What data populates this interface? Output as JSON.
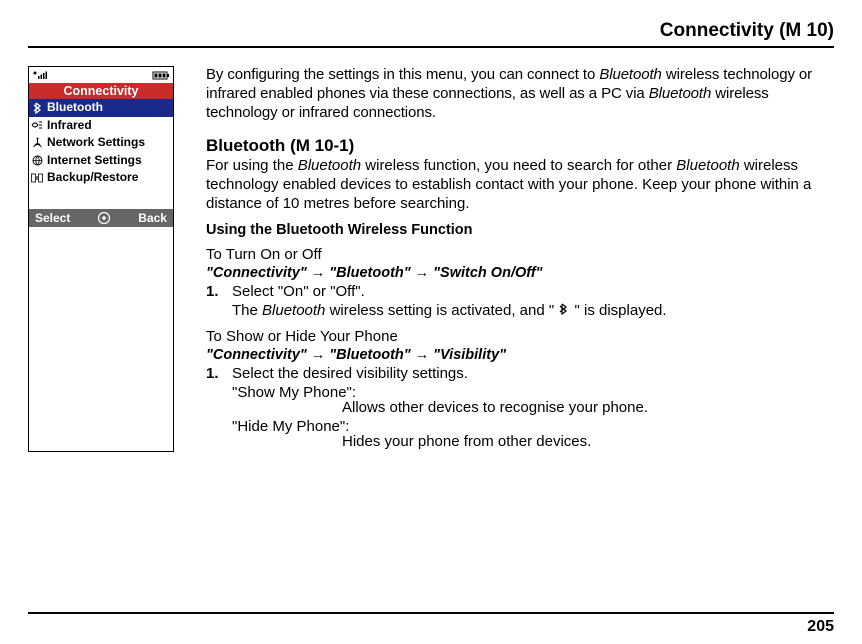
{
  "header": {
    "section": "Connectivity",
    "menu_code": "(M 10)"
  },
  "phone": {
    "title": "Connectivity",
    "items": [
      {
        "icon": "bluetooth-icon",
        "label": "Bluetooth",
        "selected": true
      },
      {
        "icon": "infrared-icon",
        "label": "Infrared",
        "selected": false
      },
      {
        "icon": "network-icon",
        "label": "Network Settings",
        "selected": false
      },
      {
        "icon": "globe-icon",
        "label": "Internet Settings",
        "selected": false
      },
      {
        "icon": "backup-icon",
        "label": "Backup/Restore",
        "selected": false
      }
    ],
    "softkeys": {
      "left": "Select",
      "right": "Back"
    }
  },
  "body": {
    "intro_before": "By configuring the settings in this menu, you can connect to ",
    "intro_bt1": "Bluetooth",
    "intro_mid": " wireless technology or infrared enabled phones via these connections, as well as a PC via ",
    "intro_bt2": "Bluetooth",
    "intro_after": " wireless technology or infrared connections.",
    "h2": "Bluetooth",
    "h2_code": "(M 10-1)",
    "p1_a": "For using the ",
    "p1_b": "Bluetooth",
    "p1_c": " wireless function, you need to search for other ",
    "p1_d": "Bluetooth",
    "p1_e": " wireless technology enabled devices to establish contact with your phone. Keep your phone within a distance of 10 metres before searching.",
    "h3": "Using the Bluetooth Wireless Function",
    "h4a": "To Turn On or Off",
    "nav1_a": "\"Connectivity\"",
    "nav1_b": "\"Bluetooth\"",
    "nav1_c": "\"Switch On/Off\"",
    "step1_num": "1.",
    "step1_txt": "Select \"On\" or \"Off\".",
    "step1_sub_a": "The ",
    "step1_sub_b": "Bluetooth",
    "step1_sub_c": " wireless setting is activated, and \" ",
    "step1_sub_d": " \" is displayed.",
    "h4b": "To Show or Hide Your Phone",
    "nav2_a": "\"Connectivity\"",
    "nav2_b": "\"Bluetooth\"",
    "nav2_c": "\"Visibility\"",
    "step2_num": "1.",
    "step2_txt": "Select the desired visibility settings.",
    "def1_t": "\"Show My Phone\":",
    "def1_d": "Allows other devices to recognise your phone.",
    "def2_t": "\"Hide My Phone\":",
    "def2_d": "Hides your phone from other devices."
  },
  "page_number": "205"
}
